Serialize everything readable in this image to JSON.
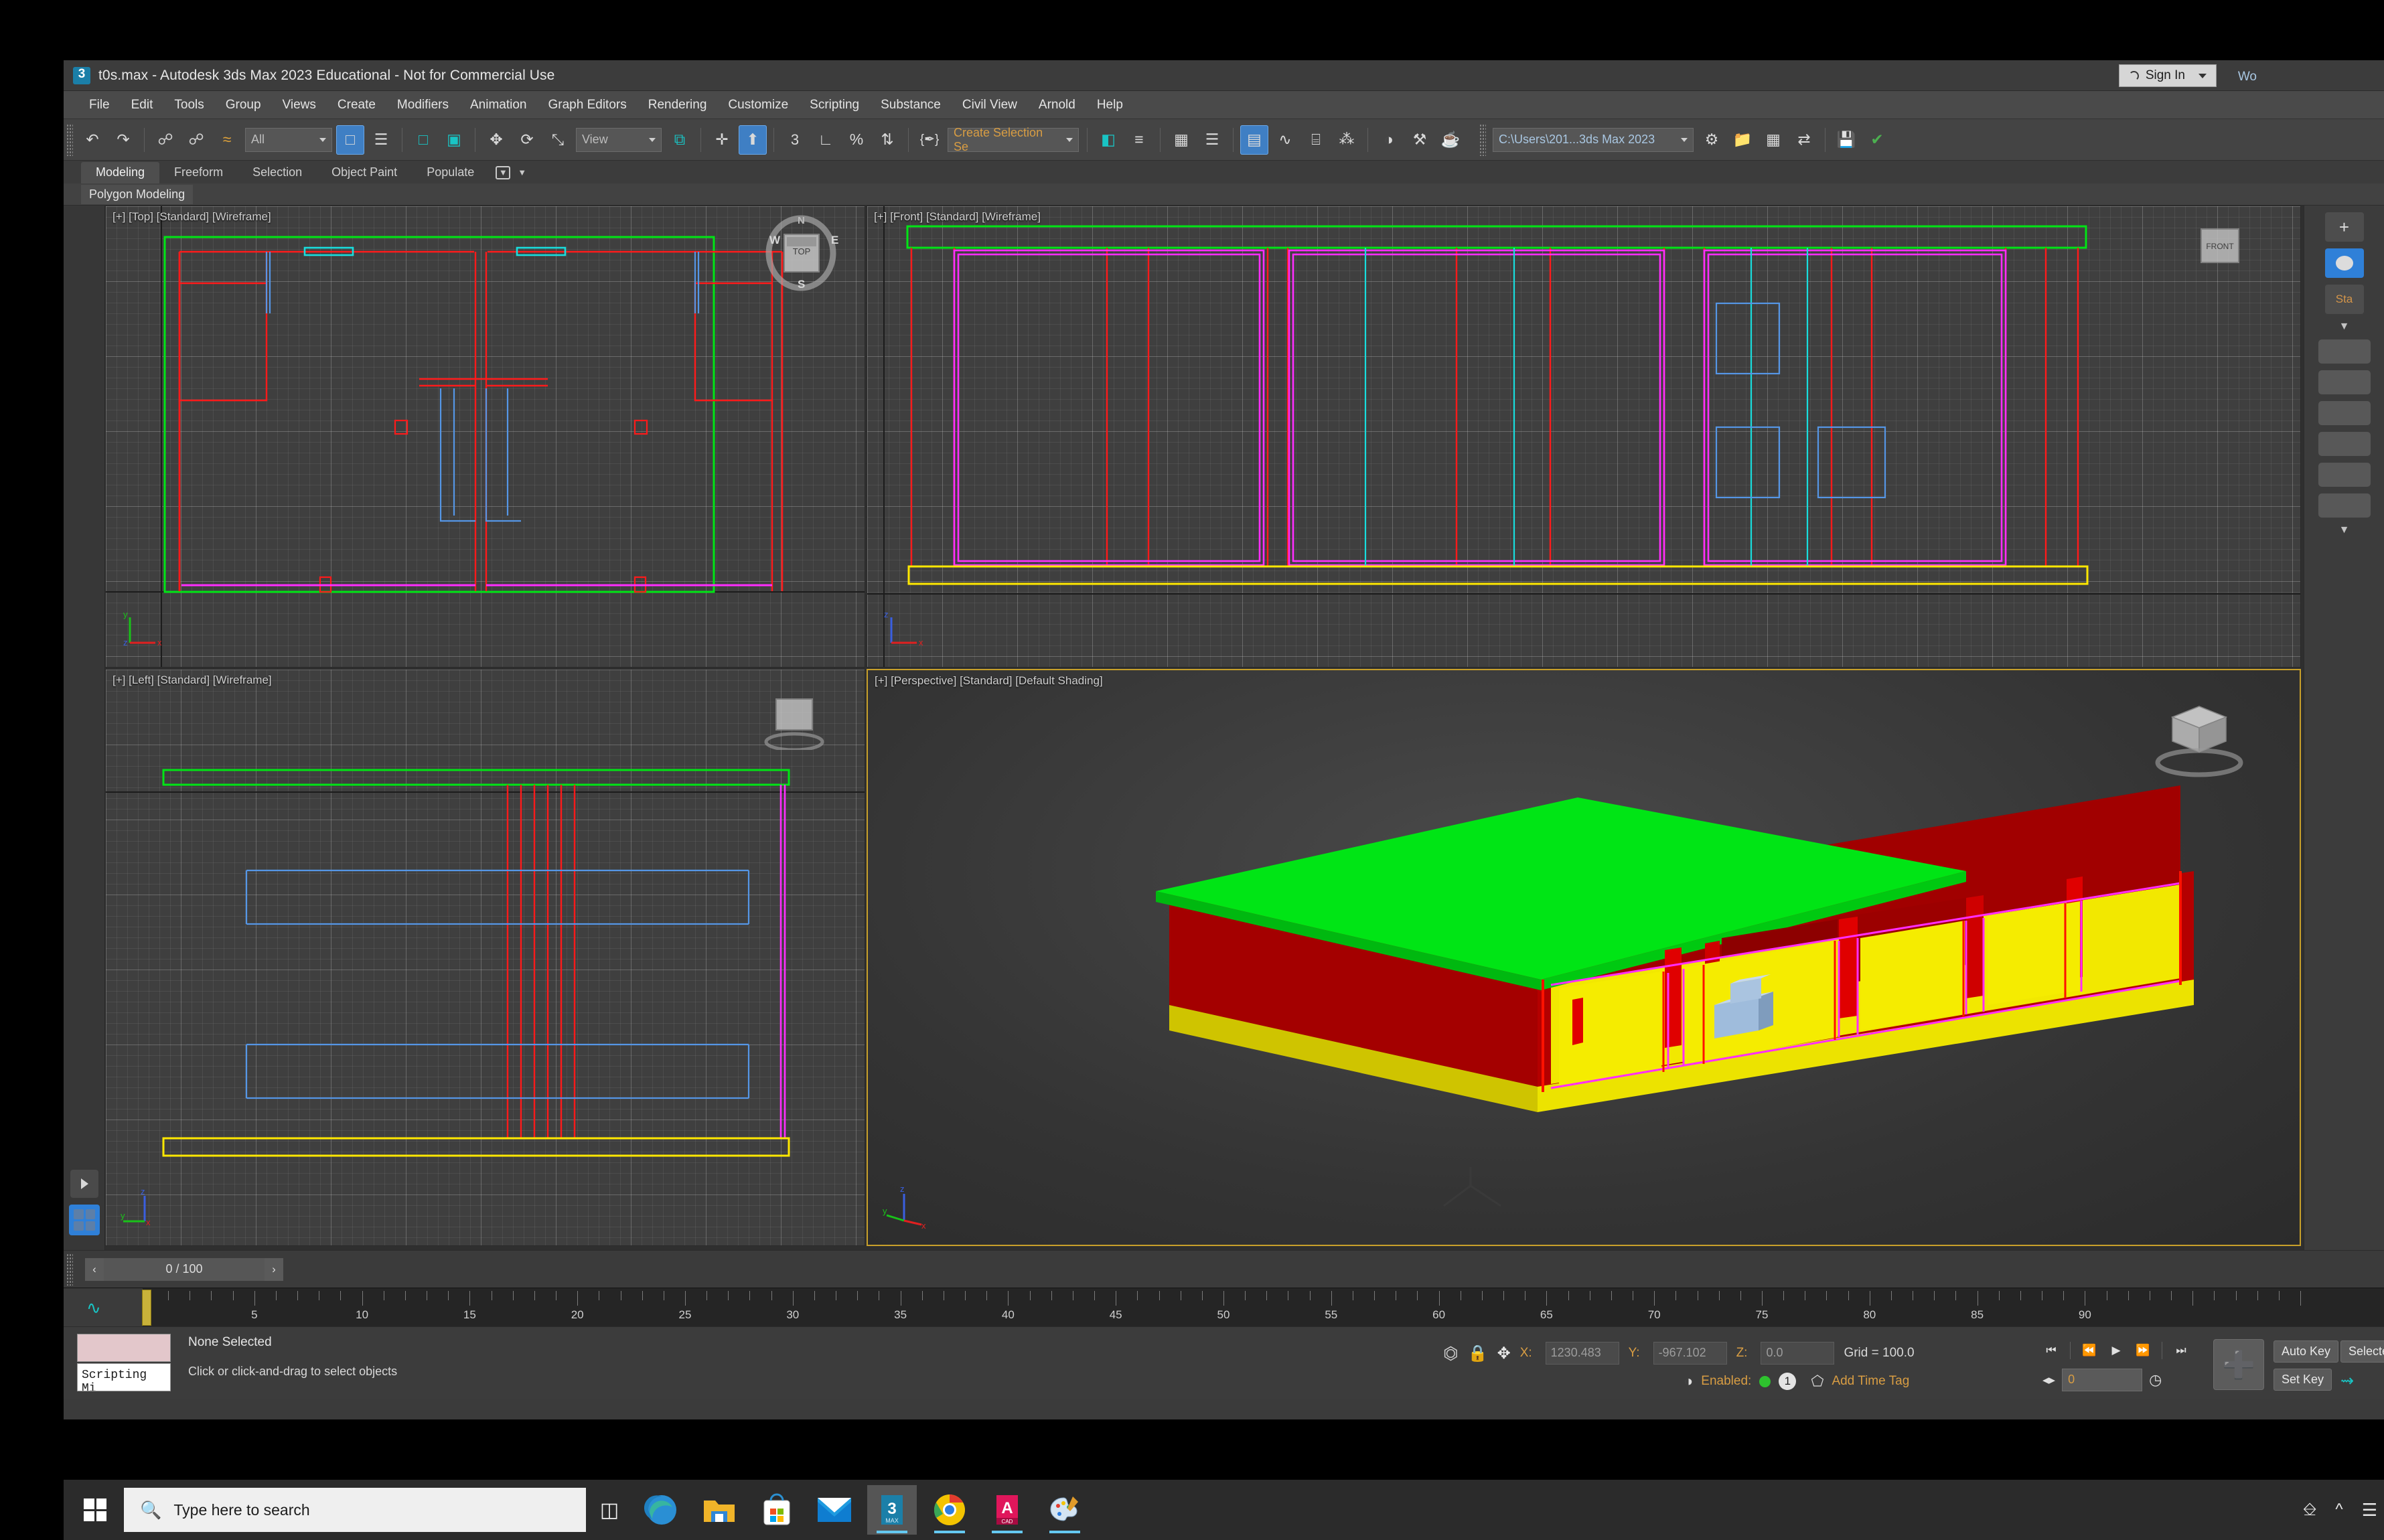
{
  "window": {
    "title": "t0s.max - Autodesk 3ds Max 2023 Educational - Not for Commercial Use",
    "app_icon": "3dsmax-icon",
    "sign_in": "Sign In",
    "workspace_label": "Wo"
  },
  "menu": {
    "items": [
      "File",
      "Edit",
      "Tools",
      "Group",
      "Views",
      "Create",
      "Modifiers",
      "Animation",
      "Graph Editors",
      "Rendering",
      "Customize",
      "Scripting",
      "Substance",
      "Civil View",
      "Arnold",
      "Help"
    ]
  },
  "toolbar": {
    "selection_filter": "All",
    "reference_coord": "View",
    "selection_set": "Create Selection Se",
    "project_path": "C:\\Users\\201...3ds Max 2023",
    "buttons": [
      {
        "name": "undo-button",
        "glyph": "↶"
      },
      {
        "name": "redo-button",
        "glyph": "↷"
      },
      {
        "name": "select-and-link-button",
        "glyph": "⚓"
      },
      {
        "name": "unlink-selection-button",
        "glyph": "⚓"
      },
      {
        "name": "bind-to-space-warp-button",
        "glyph": "≈"
      },
      {
        "name": "select-object-button",
        "glyph": "⬚"
      },
      {
        "name": "select-by-name-button",
        "glyph": "☰"
      },
      {
        "name": "rectangular-selection-region-button",
        "glyph": "□"
      },
      {
        "name": "window-crossing-toggle-button",
        "glyph": "▣"
      },
      {
        "name": "select-and-move-button",
        "glyph": "✥"
      },
      {
        "name": "select-and-rotate-button",
        "glyph": "⟳"
      },
      {
        "name": "select-and-scale-button",
        "glyph": "⤡"
      },
      {
        "name": "reference-coordinate-system-dropdown",
        "glyph": ""
      },
      {
        "name": "use-center-flyout-button",
        "glyph": "⧉"
      },
      {
        "name": "select-and-manipulate-button",
        "glyph": "✛"
      },
      {
        "name": "snaps-toggle-button",
        "glyph": "⬆"
      },
      {
        "name": "snap-3d-button",
        "glyph": "3"
      },
      {
        "name": "angle-snap-toggle-button",
        "glyph": "∠"
      },
      {
        "name": "percent-snap-toggle-button",
        "glyph": "%"
      },
      {
        "name": "spinner-snap-toggle-button",
        "glyph": "⇅"
      },
      {
        "name": "edit-named-selection-sets-button",
        "glyph": "{ }"
      },
      {
        "name": "mirror-button",
        "glyph": "◧"
      },
      {
        "name": "align-flyout-button",
        "glyph": "≡"
      },
      {
        "name": "layer-explorer-button",
        "glyph": "≣"
      },
      {
        "name": "scene-explorer-button",
        "glyph": "▦"
      },
      {
        "name": "toggle-ribbon-button",
        "glyph": "▤"
      },
      {
        "name": "curve-editor-button",
        "glyph": "∿"
      },
      {
        "name": "schematic-view-button",
        "glyph": "⌸"
      },
      {
        "name": "motion-paths-button",
        "glyph": "⁂"
      },
      {
        "name": "material-editor-button",
        "glyph": "◑"
      },
      {
        "name": "render-setup-button",
        "glyph": "⚒"
      },
      {
        "name": "render-production-button",
        "glyph": "☕"
      }
    ],
    "right_buttons": [
      {
        "name": "project-folder-settings-button",
        "glyph": "⚙"
      },
      {
        "name": "open-project-folder-button",
        "glyph": "▤"
      },
      {
        "name": "asset-tracking-button",
        "glyph": "▦"
      },
      {
        "name": "scene-converter-button",
        "glyph": "⇄"
      },
      {
        "name": "save-scene-button",
        "glyph": "💾"
      },
      {
        "name": "render-check-button",
        "glyph": "✔"
      }
    ]
  },
  "ribbon": {
    "tabs": [
      "Modeling",
      "Freeform",
      "Selection",
      "Object Paint",
      "Populate"
    ],
    "active_tab": "Modeling",
    "panel_label": "Polygon Modeling",
    "overflow_glyph": "▼"
  },
  "viewports": [
    {
      "id": "top",
      "label": "[+] [Top] [Standard] [Wireframe]",
      "point_of_view": "Top",
      "shading": "Wireframe",
      "style": "Standard",
      "active": false,
      "axis_labels": {
        "x": "x",
        "y": "y",
        "z": "z"
      },
      "viewcube_face": "TOP",
      "compass": {
        "n": "N",
        "s": "S",
        "e": "E",
        "w": "W"
      }
    },
    {
      "id": "front",
      "label": "[+] [Front] [Standard] [Wireframe]",
      "point_of_view": "Front",
      "shading": "Wireframe",
      "style": "Standard",
      "active": false,
      "axis_labels": {
        "x": "x",
        "y": "y",
        "z": "z"
      }
    },
    {
      "id": "left",
      "label": "[+] [Left] [Standard] [Wireframe]",
      "point_of_view": "Left",
      "shading": "Wireframe",
      "style": "Standard",
      "active": false,
      "axis_labels": {
        "x": "x",
        "y": "y",
        "z": "z"
      }
    },
    {
      "id": "perspective",
      "label": "[+] [Perspective] [Standard] [Default Shading]",
      "point_of_view": "Perspective",
      "shading": "Default Shading",
      "style": "Standard",
      "active": true,
      "axis_labels": {
        "x": "x",
        "y": "y",
        "z": "z"
      }
    }
  ],
  "model": {
    "description": "Shaded building shell in perspective viewport",
    "colors": {
      "roof": "#00e515",
      "wall_exterior": "#b40000",
      "wall_edge": "#ff1100",
      "floor": "#f2e800",
      "interior_floor": "#f5ec00",
      "trim_magenta": "#ff00ff",
      "furniture": "#aac4e0"
    }
  },
  "timeline": {
    "current_frame_label": "0 / 100",
    "prev_glyph": "‹",
    "next_glyph": "›",
    "start": 0,
    "end": 100,
    "playhead_frame": 0,
    "tick_labels": [
      "5",
      "10",
      "15",
      "20",
      "25",
      "30",
      "35",
      "40",
      "45",
      "50",
      "55",
      "60",
      "65",
      "70",
      "75",
      "80",
      "85",
      "90"
    ],
    "tick_step": 5
  },
  "status": {
    "selection": "None Selected",
    "prompt": "Click or click-and-drag to select objects",
    "maxscript_mini_listener": "Scripting Mi",
    "coords": {
      "x_label": "X:",
      "x_value": "1230.483",
      "y_label": "Y:",
      "y_value": "-967.102",
      "z_label": "Z:",
      "z_value": "0.0"
    },
    "grid_label": "Grid = 100.0",
    "enabled_label": "Enabled:",
    "enabled_count": "1",
    "add_time_tag": "Add Time Tag",
    "icons": [
      {
        "name": "selection-lock-toggle-icon"
      },
      {
        "name": "absolute-relative-transform-toggle-icon"
      },
      {
        "name": "isolate-selection-icon"
      }
    ]
  },
  "animation": {
    "auto_key_label": "Auto Key",
    "set_key_label": "Set Key",
    "key_filters_label": "Selecte",
    "frame_value": "0",
    "playback": [
      {
        "name": "go-to-start-button",
        "glyph": "⏮"
      },
      {
        "name": "previous-frame-button",
        "glyph": "⏪"
      },
      {
        "name": "play-animation-button",
        "glyph": "▶"
      },
      {
        "name": "next-frame-button",
        "glyph": "⏩"
      },
      {
        "name": "go-to-end-button",
        "glyph": "⏭"
      }
    ]
  },
  "viewport_nav": {
    "expand_button_glyph": "▶",
    "layout_button_name": "viewport-layout-button"
  },
  "taskbar": {
    "search_placeholder": "Type here to search",
    "start_button": "start-button",
    "task_view": "task-view-button",
    "apps": [
      {
        "name": "microsoft-edge-icon",
        "label": "Microsoft Edge",
        "active": false
      },
      {
        "name": "file-explorer-icon",
        "label": "File Explorer",
        "active": false
      },
      {
        "name": "microsoft-store-icon",
        "label": "Microsoft Store",
        "active": false
      },
      {
        "name": "mail-icon",
        "label": "Mail",
        "active": false
      },
      {
        "name": "3dsmax-icon",
        "label": "3ds Max",
        "active": true
      },
      {
        "name": "google-chrome-icon",
        "label": "Google Chrome",
        "active": false
      },
      {
        "name": "autocad-icon",
        "label": "AutoCAD",
        "active": false
      },
      {
        "name": "paint-icon",
        "label": "Paint",
        "active": false
      }
    ],
    "tray": [
      {
        "name": "keyboard-layout-icon"
      },
      {
        "name": "show-hidden-icons-icon"
      },
      {
        "name": "network-icon"
      }
    ]
  }
}
